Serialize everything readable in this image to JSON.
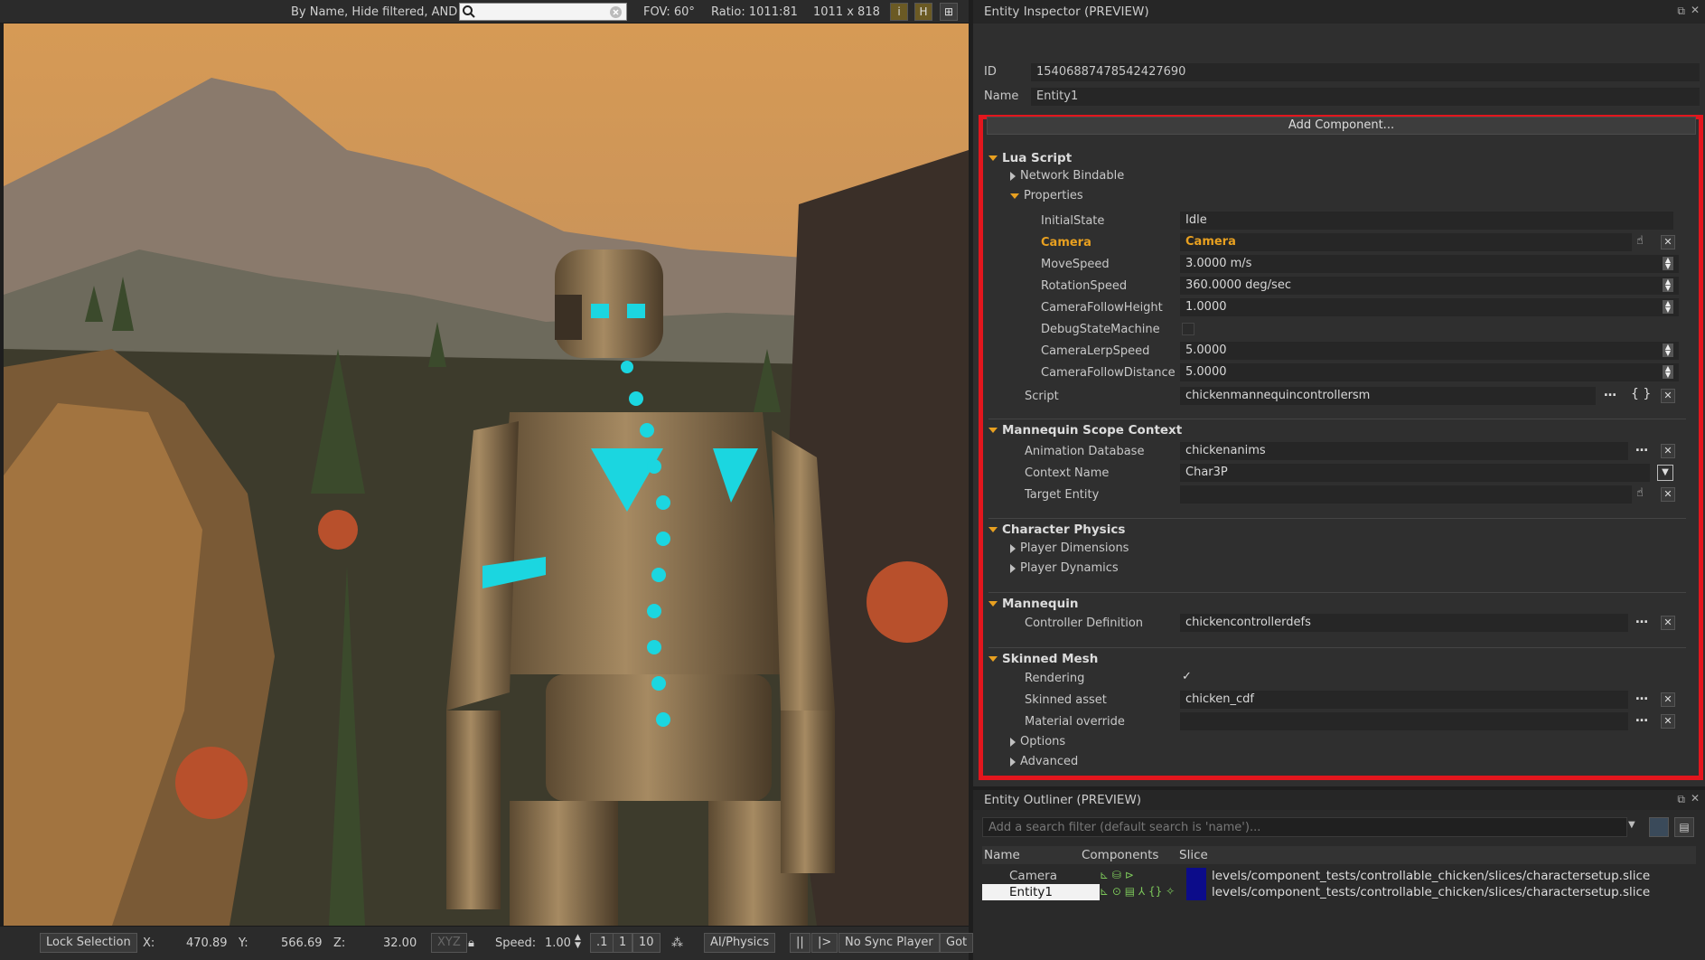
{
  "viewport_topbar": {
    "filter_label": "By Name, Hide filtered, AND",
    "fov": "FOV: 60°",
    "ratio": "Ratio: 1011:81",
    "size": "1011 x 818",
    "buttons": [
      "i",
      "H",
      "⊞"
    ]
  },
  "viewport_bottombar": {
    "lock_selection": "Lock Selection",
    "x_label": "X:",
    "x_value": "470.89",
    "y_label": "Y:",
    "y_value": "566.69",
    "z_label": "Z:",
    "z_value": "32.00",
    "xyz": "XYZ",
    "speed_label": "Speed:",
    "speed_value": "1.00",
    "speed_presets": [
      ".1",
      "1",
      "10"
    ],
    "ai_physics": "AI/Physics",
    "pause": "||",
    "step": "|>",
    "sync": "No Sync Player",
    "goto": "Got"
  },
  "inspector": {
    "title": "Entity Inspector (PREVIEW)",
    "id_label": "ID",
    "id_value": "15406887478542427690",
    "name_label": "Name",
    "name_value": "Entity1",
    "add_component": "Add Component...",
    "lua": {
      "header": "Lua Script",
      "network_bindable": "Network Bindable",
      "properties": "Properties",
      "rows": [
        {
          "label": "InitialState",
          "value": "Idle"
        },
        {
          "label": "Camera",
          "value": "Camera"
        },
        {
          "label": "MoveSpeed",
          "value": "3.0000 m/s"
        },
        {
          "label": "RotationSpeed",
          "value": "360.0000 deg/sec"
        },
        {
          "label": "CameraFollowHeight",
          "value": "1.0000"
        },
        {
          "label": "DebugStateMachine",
          "value": ""
        },
        {
          "label": "CameraLerpSpeed",
          "value": "5.0000"
        },
        {
          "label": "CameraFollowDistance",
          "value": "5.0000"
        }
      ],
      "script_label": "Script",
      "script_value": "chickenmannequincontrollersm"
    },
    "mannequin_scope": {
      "header": "Mannequin Scope Context",
      "anim_db_label": "Animation Database",
      "anim_db_value": "chickenanims",
      "context_label": "Context Name",
      "context_value": "Char3P",
      "target_label": "Target Entity",
      "target_value": ""
    },
    "char_physics": {
      "header": "Character Physics",
      "player_dimensions": "Player Dimensions",
      "player_dynamics": "Player Dynamics"
    },
    "mannequin": {
      "header": "Mannequin",
      "controller_label": "Controller Definition",
      "controller_value": "chickencontrollerdefs"
    },
    "skinned_mesh": {
      "header": "Skinned Mesh",
      "rendering_label": "Rendering",
      "rendering_value": "✓",
      "asset_label": "Skinned asset",
      "asset_value": "chicken_cdf",
      "material_label": "Material override",
      "material_value": "",
      "options": "Options",
      "advanced": "Advanced"
    },
    "accent_color": "#e3161d",
    "highlight_color": "#e8a020"
  },
  "outliner": {
    "title": "Entity Outliner (PREVIEW)",
    "filter_placeholder": "Add a search filter (default search is 'name')...",
    "columns": [
      "Name",
      "Components",
      "Slice"
    ],
    "rows": [
      {
        "name": "Camera",
        "components": "⊾ ⛁ ⊳",
        "slice": "levels/component_tests/controllable_chicken/slices/charactersetup.slice"
      },
      {
        "name": "Entity1",
        "components": "⊾ ⊙ ▤ ⅄ {} ✧",
        "slice": "levels/component_tests/controllable_chicken/slices/charactersetup.slice"
      }
    ]
  }
}
